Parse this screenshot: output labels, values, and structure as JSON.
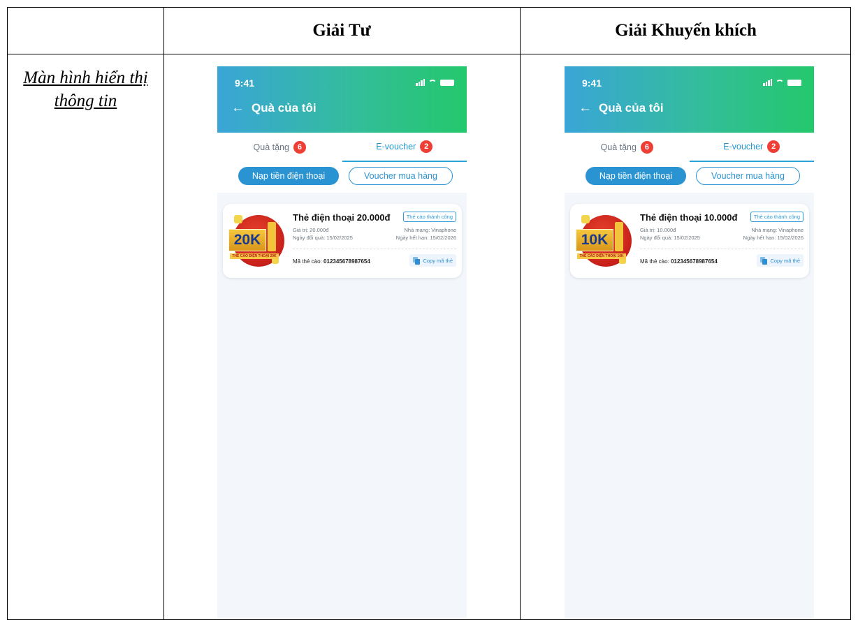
{
  "table": {
    "headers": [
      "",
      "Giải Tư",
      "Giải Khuyến khích"
    ],
    "row_label": "Màn hình hiển thị thông tin"
  },
  "phones": [
    {
      "status_time": "9:41",
      "nav_title": "Quà của tôi",
      "tabs": [
        {
          "label": "Quà tặng",
          "badge": "6",
          "active": false
        },
        {
          "label": "E-voucher",
          "badge": "2",
          "active": true
        }
      ],
      "chips": [
        "Nạp tiền điện thoại",
        "Voucher mua hàng"
      ],
      "card": {
        "title": "Thẻ điện thoại 20.000đ",
        "status": "Thẻ cào thành công",
        "value": "Giá trị: 20.000đ",
        "network": "Nhà mạng: Vinaphone",
        "redeem_date": "Ngày đổi quà: 15/02/2025",
        "expiry_date": "Ngày hết hạn: 15/02/2026",
        "code_label": "Mã thẻ cào:",
        "code_value": "012345678987654",
        "copy_label": "Copy mã thẻ",
        "prize_amount": "20K",
        "prize_strip": "THẺ CÀO ĐIỆN THOẠI 20K"
      }
    },
    {
      "status_time": "9:41",
      "nav_title": "Quà của tôi",
      "tabs": [
        {
          "label": "Quà tặng",
          "badge": "6",
          "active": false
        },
        {
          "label": "E-voucher",
          "badge": "2",
          "active": true
        }
      ],
      "chips": [
        "Nạp tiền điện thoại",
        "Voucher mua hàng"
      ],
      "card": {
        "title": "Thẻ điện thoại 10.000đ",
        "status": "Thẻ cào thành công",
        "value": "Giá trị: 10.000đ",
        "network": "Nhà mạng: Vinaphone",
        "redeem_date": "Ngày đổi quà: 15/02/2025",
        "expiry_date": "Ngày hết hạn: 15/02/2026",
        "code_label": "Mã thẻ cào:",
        "code_value": "012345678987654",
        "copy_label": "Copy mã thẻ",
        "prize_amount": "10K",
        "prize_strip": "THẺ CÀO ĐIỆN THOẠI 10K"
      }
    }
  ],
  "colors": {
    "header_gradient_start": "#3aa5d8",
    "header_gradient_end": "#24c86c",
    "accent_blue": "#2a93d2",
    "badge_red": "#ef3e36"
  }
}
